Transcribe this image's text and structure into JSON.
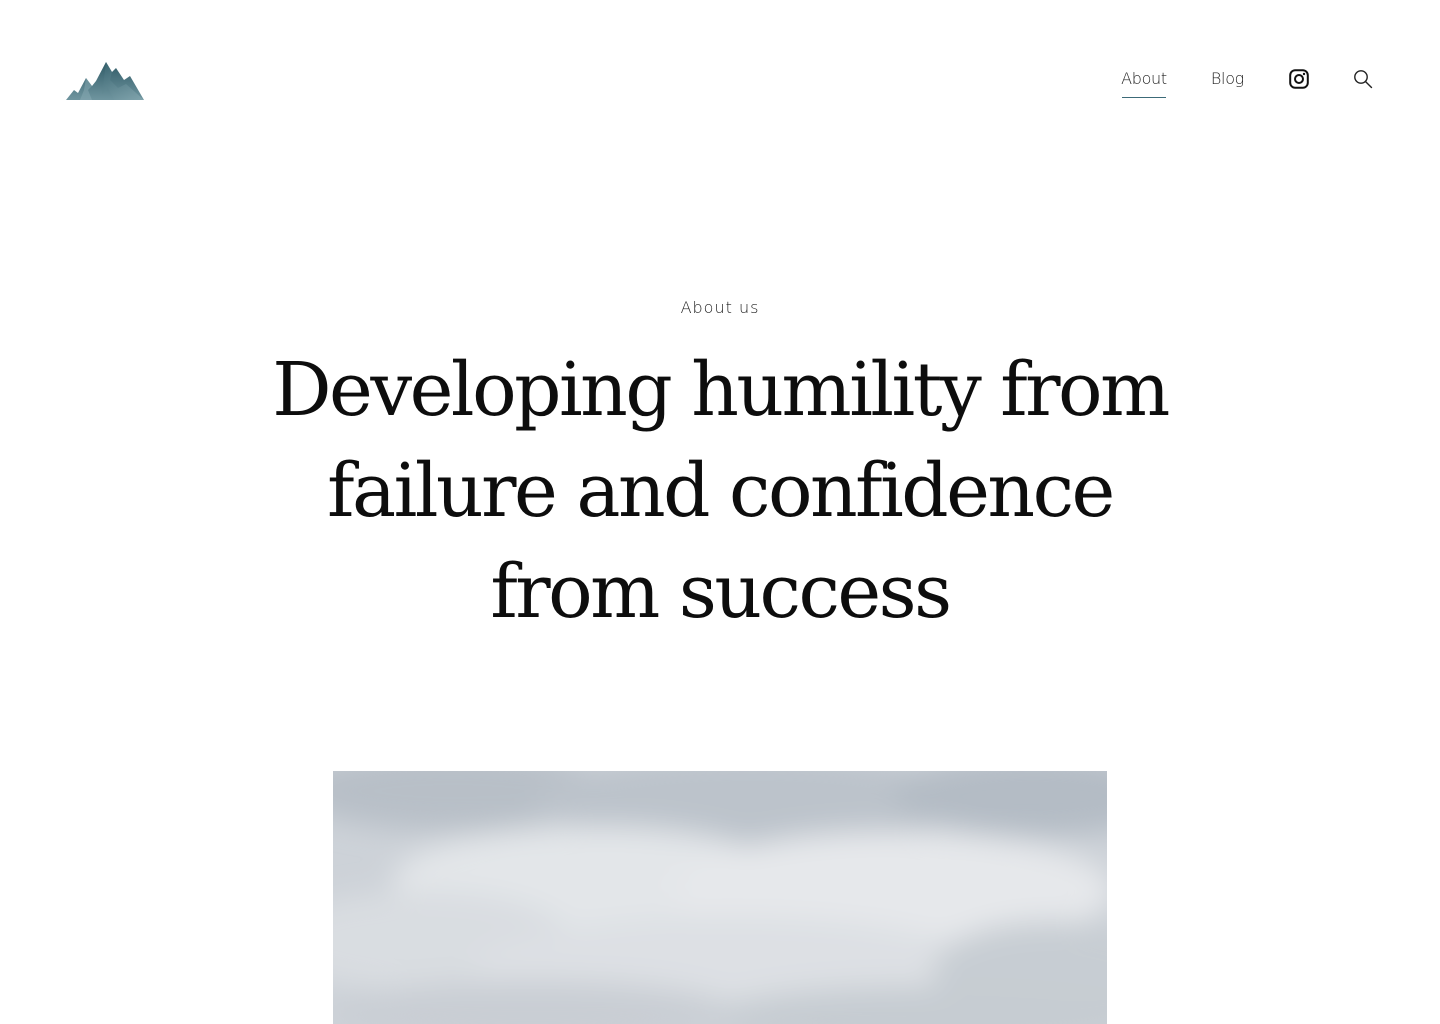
{
  "header": {
    "logo_icon": "mountain-logo-icon",
    "nav": {
      "about_label": "About",
      "blog_label": "Blog",
      "instagram_icon": "instagram-icon",
      "search_icon": "search-icon"
    }
  },
  "hero": {
    "eyebrow": "About us",
    "headline": "Developing humility from failure and confidence from success"
  },
  "image": {
    "subject": "cloudy-sky-photo"
  },
  "colors": {
    "accent": "#3c6a78",
    "logo_dark": "#2f5a66",
    "logo_light": "#7ea3ad",
    "text": "#111111"
  }
}
